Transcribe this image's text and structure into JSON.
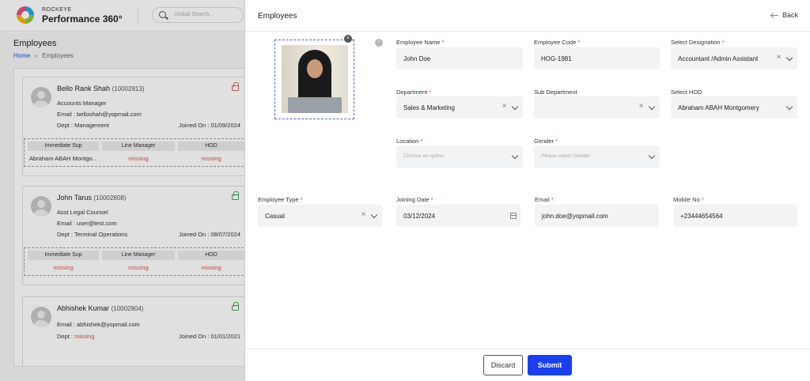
{
  "brand": {
    "top": "ROCKEYE",
    "main": "Performance 360°"
  },
  "global_search": {
    "placeholder": "Global Search..."
  },
  "background": {
    "title": "Employees",
    "breadcrumb": {
      "home": "Home",
      "separator": "»",
      "current": "Employees"
    },
    "employees": [
      {
        "name": "Bello Rank Shah",
        "code": "(10002813)",
        "designation": "Accounts Manager",
        "email_label": "Email :",
        "email": "belloshah@yopmail.com",
        "dept_label": "Dept :",
        "dept": "Management",
        "joined_label": "Joined On :",
        "joined": "01/09/2024",
        "lock": "locked",
        "sup_headers": [
          "Immediate Sup",
          "Line Manager",
          "HOD"
        ],
        "sup_values": [
          "Abraham ABAH Montgo...",
          "missing",
          "missing"
        ]
      },
      {
        "name": "John Tarus",
        "code": "(10002808)",
        "designation": "Asst Legal Counsel",
        "email_label": "Email :",
        "email": "user@test.com",
        "dept_label": "Dept :",
        "dept": "Terminal Operations",
        "joined_label": "Joined On :",
        "joined": "08/07/2024",
        "lock": "unlocked",
        "sup_headers": [
          "Immediate Sup",
          "Line Manager",
          "HOD"
        ],
        "sup_values": [
          "missing",
          "missing",
          "missing"
        ]
      },
      {
        "name": "Abhishek Kumar",
        "code": "(10002804)",
        "email_label": "Email :",
        "email": "abhishek@yopmail.com",
        "dept_label": "Dept :",
        "dept": "missing",
        "joined_label": "Joined On :",
        "joined": "01/01/2021",
        "lock": "unlocked"
      }
    ]
  },
  "drawer": {
    "title": "Employees",
    "back_label": "Back",
    "photo_remove": "×",
    "info": "!",
    "required_mark": "*",
    "fields": {
      "employee_name": {
        "label": "Employee Name",
        "value": "John Doe"
      },
      "employee_code": {
        "label": "Employee Code",
        "value": "HOG-1981"
      },
      "designation": {
        "label": "Select Designation",
        "value": "Accountant /Admin Assistant"
      },
      "department": {
        "label": "Department",
        "value": "Sales & Marketing"
      },
      "sub_department": {
        "label": "Sub Department",
        "value": ""
      },
      "hod": {
        "label": "Select HOD",
        "value": "Abraham ABAH Montgomery"
      },
      "location": {
        "label": "Location",
        "placeholder": "Choose an option"
      },
      "gender": {
        "label": "Gender",
        "placeholder": "Please select Gender"
      },
      "employee_type": {
        "label": "Employee Type",
        "value": "Casual"
      },
      "joining_date": {
        "label": "Joining Date",
        "value": "03/12/2024"
      },
      "email": {
        "label": "Email",
        "value": "john.doe@yopmail.com"
      },
      "mobile": {
        "label": "Mobile No",
        "value": "+23444654564"
      }
    },
    "footer": {
      "discard_label": "Discard",
      "submit_label": "Submit"
    }
  },
  "colors": {
    "accent": "#1a3ff0",
    "required": "#e04040",
    "missing": "#d9534f",
    "lock_red": "#e05a5a",
    "lock_green": "#3aa64f"
  }
}
